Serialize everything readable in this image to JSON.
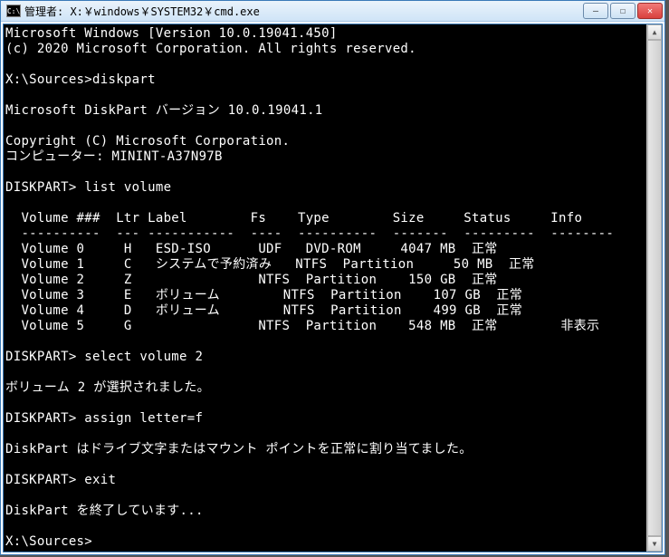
{
  "window": {
    "icon_text": "C:\\",
    "title": "管理者: X:￥windows￥SYSTEM32￥cmd.exe",
    "buttons": {
      "min": "—",
      "max": "☐",
      "close": "✕"
    }
  },
  "lines": [
    "Microsoft Windows [Version 10.0.19041.450]",
    "(c) 2020 Microsoft Corporation. All rights reserved.",
    "",
    "X:\\Sources>diskpart",
    "",
    "Microsoft DiskPart バージョン 10.0.19041.1",
    "",
    "Copyright (C) Microsoft Corporation.",
    "コンピューター: MININT-A37N97B",
    "",
    "DISKPART> list volume",
    "",
    "  Volume ###  Ltr Label        Fs    Type        Size     Status     Info",
    "  ----------  --- -----------  ----  ----------  -------  ---------  --------",
    "  Volume 0     H   ESD-ISO      UDF   DVD-ROM     4047 MB  正常",
    "  Volume 1     C   システムで予約済み   NTFS  Partition     50 MB  正常",
    "  Volume 2     Z                NTFS  Partition    150 GB  正常",
    "  Volume 3     E   ボリューム        NTFS  Partition    107 GB  正常",
    "  Volume 4     D   ボリューム        NTFS  Partition    499 GB  正常",
    "  Volume 5     G                NTFS  Partition    548 MB  正常        非表示",
    "",
    "DISKPART> select volume 2",
    "",
    "ボリューム 2 が選択されました。",
    "",
    "DISKPART> assign letter=f",
    "",
    "DiskPart はドライブ文字またはマウント ポイントを正常に割り当てました。",
    "",
    "DISKPART> exit",
    "",
    "DiskPart を終了しています...",
    "",
    "X:\\Sources>"
  ]
}
